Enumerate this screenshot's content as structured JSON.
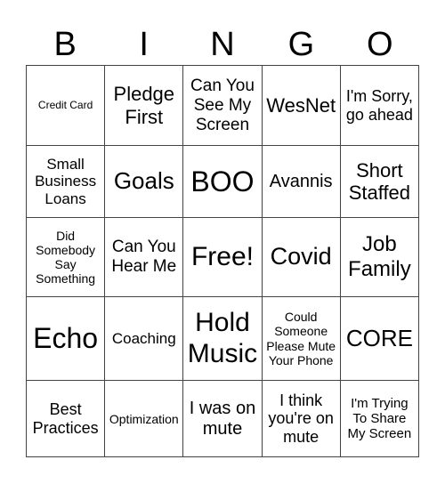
{
  "header": [
    "B",
    "I",
    "N",
    "G",
    "O"
  ],
  "rows": [
    [
      "Credit Card",
      "Pledge First",
      "Can You See My Screen",
      "WesNet",
      "I'm Sorry, go ahead"
    ],
    [
      "Small Business Loans",
      "Goals",
      "BOO",
      "Avannis",
      "Short Staffed"
    ],
    [
      "Did Somebody Say Something",
      "Can You Hear Me",
      "Free!",
      "Covid",
      "Job Family"
    ],
    [
      "Echo",
      "Coaching",
      "Hold Music",
      "Could Someone Please Mute Your Phone",
      "CORE"
    ],
    [
      "Best Practices",
      "Optimization",
      "I was on mute",
      "I think you're on mute",
      "I'm Trying To Share My Screen"
    ]
  ]
}
